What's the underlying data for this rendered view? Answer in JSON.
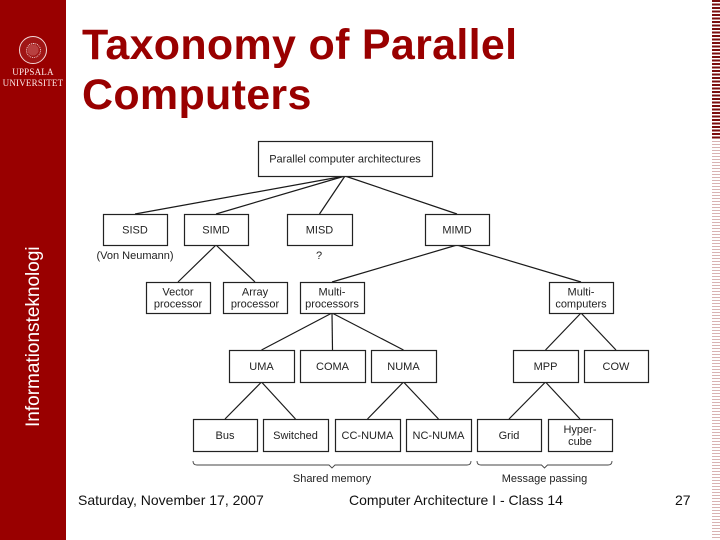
{
  "sidebar": {
    "logo_lines": [
      "UPPSALA",
      "UNIVERSITET"
    ],
    "logo_icon": "university-seal-icon",
    "vertical_label": "Informationsteknologi",
    "color": "#990000"
  },
  "title": {
    "line1": "Taxonomy of Parallel",
    "line2": "Computers",
    "color": "#990000"
  },
  "diagram": {
    "nodes": [
      {
        "id": "root",
        "lines": [
          "Parallel computer architectures"
        ]
      },
      {
        "id": "sisd",
        "lines": [
          "SISD"
        ]
      },
      {
        "id": "simd",
        "lines": [
          "SIMD"
        ]
      },
      {
        "id": "misd",
        "lines": [
          "MISD"
        ]
      },
      {
        "id": "mimd",
        "lines": [
          "MIMD"
        ]
      },
      {
        "id": "vector",
        "lines": [
          "Vector",
          "processor"
        ]
      },
      {
        "id": "array",
        "lines": [
          "Array",
          "processor"
        ]
      },
      {
        "id": "multiproc",
        "lines": [
          "Multi-",
          "processors"
        ]
      },
      {
        "id": "multicomp",
        "lines": [
          "Multi-",
          "computers"
        ]
      },
      {
        "id": "uma",
        "lines": [
          "UMA"
        ]
      },
      {
        "id": "coma",
        "lines": [
          "COMA"
        ]
      },
      {
        "id": "numa",
        "lines": [
          "NUMA"
        ]
      },
      {
        "id": "mpp",
        "lines": [
          "MPP"
        ]
      },
      {
        "id": "cow",
        "lines": [
          "COW"
        ]
      },
      {
        "id": "bus",
        "lines": [
          "Bus"
        ]
      },
      {
        "id": "switched",
        "lines": [
          "Switched"
        ]
      },
      {
        "id": "ccnuma",
        "lines": [
          "CC-NUMA"
        ]
      },
      {
        "id": "ncnuma",
        "lines": [
          "NC-NUMA"
        ]
      },
      {
        "id": "grid",
        "lines": [
          "Grid"
        ]
      },
      {
        "id": "hypercube",
        "lines": [
          "Hyper-",
          "cube"
        ]
      }
    ],
    "edges": [
      [
        "root",
        "sisd"
      ],
      [
        "root",
        "simd"
      ],
      [
        "root",
        "misd"
      ],
      [
        "root",
        "mimd"
      ],
      [
        "simd",
        "vector"
      ],
      [
        "simd",
        "array"
      ],
      [
        "mimd",
        "multiproc"
      ],
      [
        "mimd",
        "multicomp"
      ],
      [
        "multiproc",
        "uma"
      ],
      [
        "multiproc",
        "coma"
      ],
      [
        "multiproc",
        "numa"
      ],
      [
        "multicomp",
        "mpp"
      ],
      [
        "multicomp",
        "cow"
      ],
      [
        "uma",
        "bus"
      ],
      [
        "uma",
        "switched"
      ],
      [
        "numa",
        "ccnuma"
      ],
      [
        "numa",
        "ncnuma"
      ],
      [
        "mpp",
        "grid"
      ],
      [
        "mpp",
        "hypercube"
      ]
    ],
    "annotations": [
      {
        "id": "von-neumann",
        "text": "(Von Neumann)",
        "under": "sisd"
      },
      {
        "id": "misd-unknown",
        "text": "?",
        "under": "misd"
      }
    ],
    "groups": [
      {
        "id": "shared-memory",
        "label": "Shared memory",
        "from": "bus",
        "to": "ncnuma"
      },
      {
        "id": "message-passing",
        "label": "Message passing",
        "from": "grid",
        "to": "hypercube"
      }
    ]
  },
  "footer": {
    "date": "Saturday, November 17, 2007",
    "course": "Computer Architecture I - Class 14",
    "page_number": "27"
  }
}
